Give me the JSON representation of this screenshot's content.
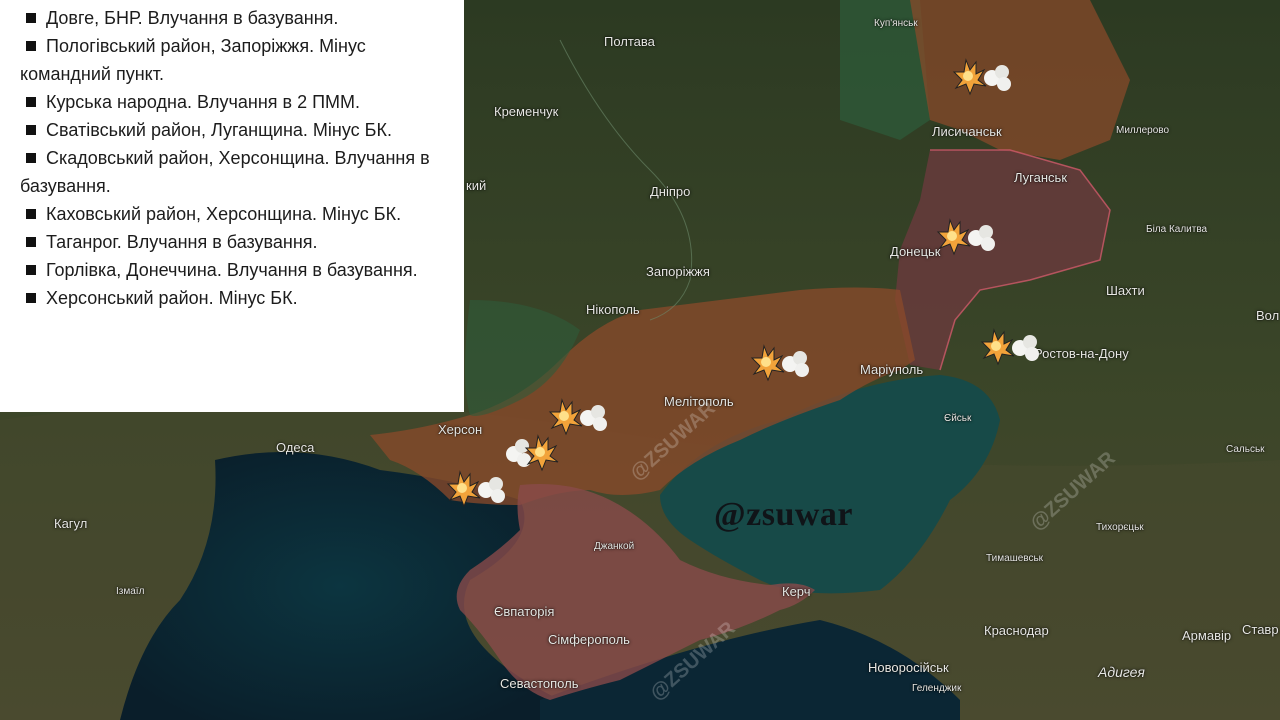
{
  "strikes_list": [
    {
      "text": "Довге, БНР. Влучання в базування."
    },
    {
      "text": "Пологівський район, Запоріжжя. Мінус командний пункт."
    },
    {
      "text": "Курська народна. Влучання в 2 ПММ."
    },
    {
      "text": "Сватівський район, Луганщина. Мінус БК."
    },
    {
      "text": "Скадовський район, Херсонщина. Влучання в базування."
    },
    {
      "text": "Каховський район, Херсонщина. Мінус БК."
    },
    {
      "text": "Таганрог. Влучання в базування."
    },
    {
      "text": "Горлівка, Донеччина. Влучання в базування."
    },
    {
      "text": "Херсонський район. Мінус БК."
    }
  ],
  "map": {
    "brand": "@zsuwar",
    "watermark": "@ZSUWAR",
    "occupied_color": "#8a4a2a",
    "lpr_dpr_color": "#6b3a3e",
    "crimea_color": "#8a4a4a",
    "sea_color": "#0e3a44",
    "marker_icon": "explosion-icon",
    "cities": {
      "kupiansk": "Куп'янськ",
      "poltava": "Полтава",
      "kremenchuk": "Кременчук",
      "lysychansk": "Лисичанськ",
      "millerovo": "Миллерово",
      "luhansk": "Луганськ",
      "dnipro": "Дніпро",
      "bila_kalytva": "Біла Калитва",
      "donetsk": "Донецьк",
      "zaporizhzhia": "Запоріжжя",
      "shakhty": "Шахти",
      "nikopol": "Нікополь",
      "volgodonsk": "Вол",
      "mariupol": "Маріуполь",
      "rostov": "Ростов-на-Дону",
      "melitopol": "Мелітополь",
      "kherson": "Херсон",
      "yeysk": "Єйськ",
      "odesa": "Одеса",
      "salsk": "Сальськ",
      "kahul": "Кагул",
      "tikhoretsk": "Тихорєцьк",
      "dzhankoi": "Джанкой",
      "izmail": "Ізмаїл",
      "tymashevsk": "Тимашевськ",
      "yevpatoria": "Євпаторія",
      "kerch": "Керч",
      "krasnodar": "Краснодар",
      "armavir": "Армавір",
      "stavropol": "Ставр",
      "simferopol": "Сімферополь",
      "novorossiysk": "Новоросійськ",
      "adygea": "Адигея",
      "sevastopol": "Севастополь",
      "gelendzhik": "Геленджик",
      "kyiv_partial": "кий"
    }
  }
}
